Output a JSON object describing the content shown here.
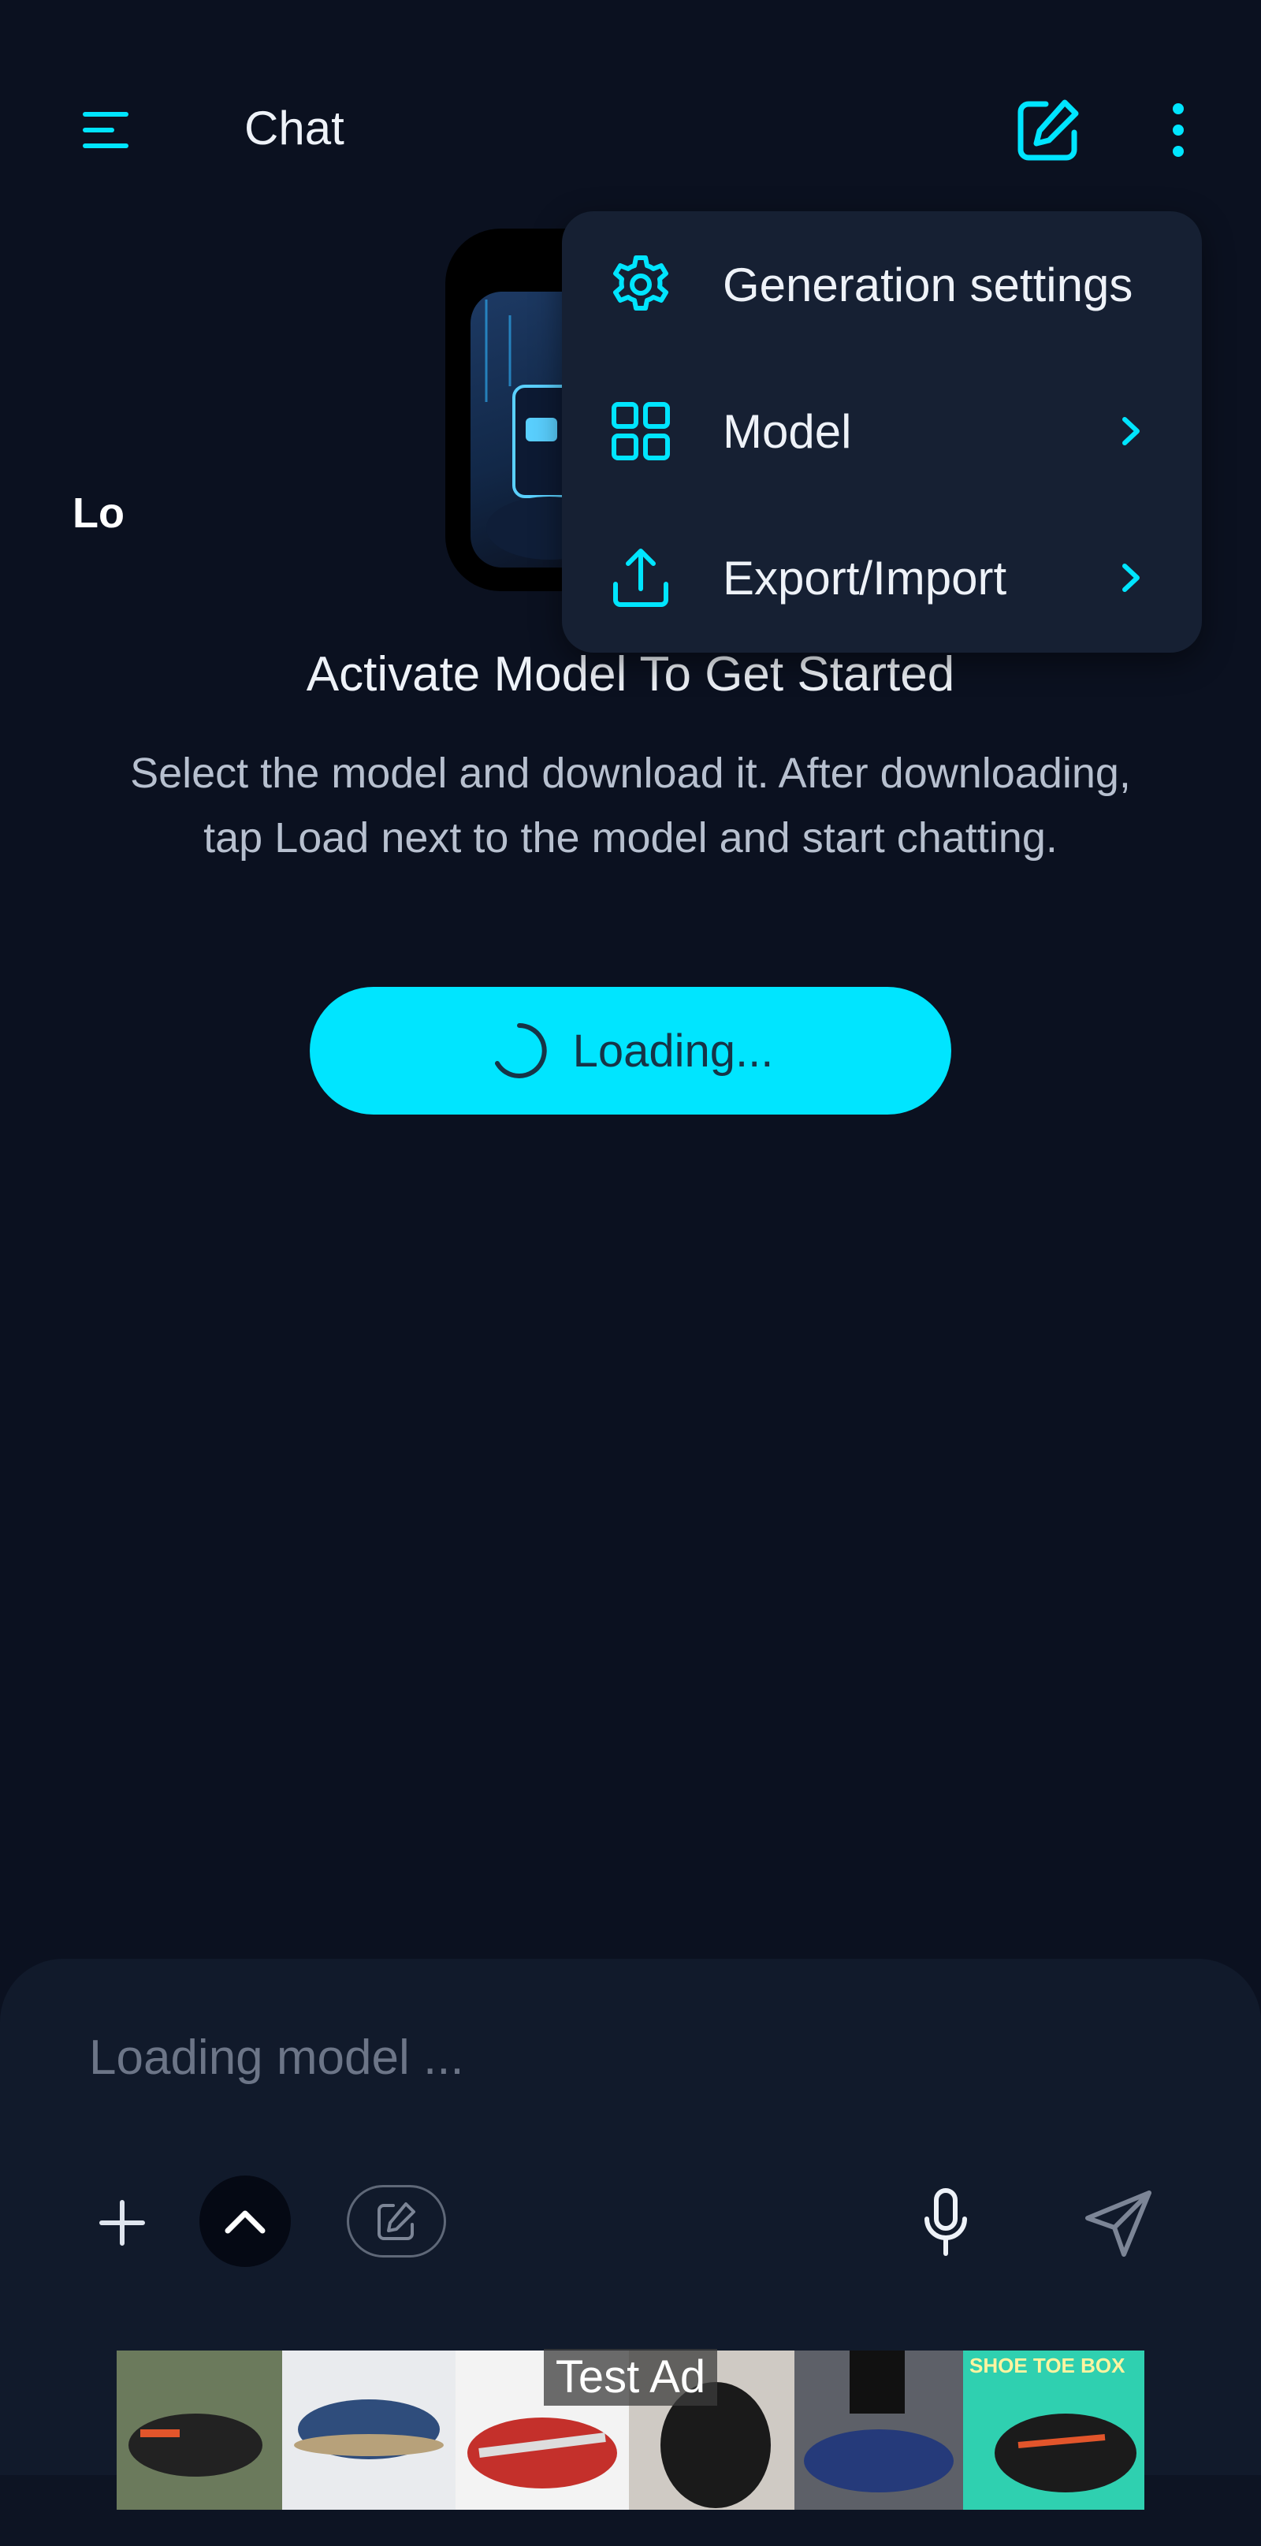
{
  "app_bar": {
    "title": "Chat",
    "menu_icon": "hamburger-menu-icon",
    "new_chat_icon": "edit-square-icon",
    "more_icon": "more-vertical-icon"
  },
  "empty_state": {
    "hero_text": "Lo",
    "title": "Activate Model To Get Started",
    "description": "Select the model and download it. After downloading, tap Load next to the model and start chatting.",
    "button_label": "Loading..."
  },
  "dropdown": {
    "items": [
      {
        "label": "Generation settings",
        "icon": "gear-icon",
        "has_submenu": false
      },
      {
        "label": "Model",
        "icon": "grid-icon",
        "has_submenu": true
      },
      {
        "label": "Export/Import",
        "icon": "upload-icon",
        "has_submenu": true
      }
    ]
  },
  "composer": {
    "placeholder": "Loading model ...",
    "add_icon": "plus-icon",
    "expand_icon": "chevron-up-icon",
    "edit_icon": "edit-pencil-icon",
    "mic_icon": "microphone-icon",
    "send_icon": "send-icon"
  },
  "ad": {
    "label": "Test Ad",
    "banner_text": "SHOE TOE BOX"
  },
  "colors": {
    "background": "#0b1120",
    "accent": "#00e5ff",
    "menu_bg": "#162033",
    "panel_bg": "#111a2b"
  }
}
